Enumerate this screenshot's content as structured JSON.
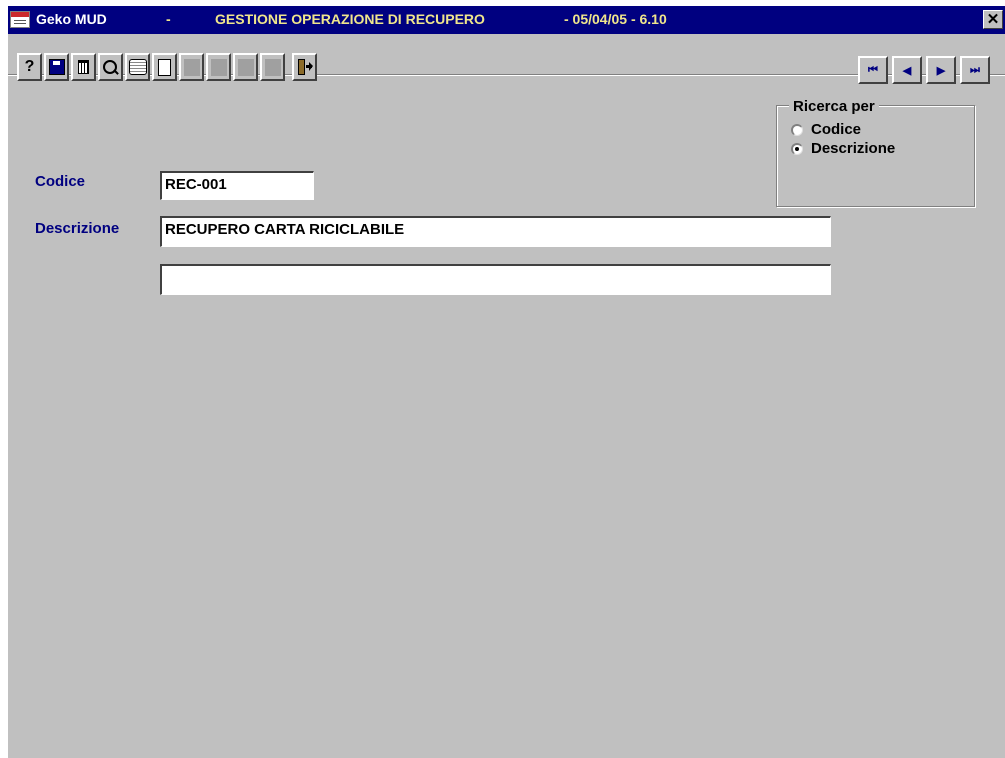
{
  "window": {
    "app_name": "Geko MUD",
    "separator": "-",
    "form_title": "GESTIONE OPERAZIONE DI RECUPERO",
    "datetime": "- 05/04/05 - 6.10",
    "close_label": "✕"
  },
  "toolbar": {
    "buttons": [
      {
        "name": "help-icon",
        "glyph": "?"
      },
      {
        "name": "save-icon",
        "glyph": "▪"
      },
      {
        "name": "trash-icon",
        "glyph": "🗑"
      },
      {
        "name": "search-icon",
        "glyph": "⌕"
      },
      {
        "name": "print-icon",
        "glyph": "❐"
      },
      {
        "name": "new-document-icon",
        "glyph": "▯"
      }
    ],
    "exit_glyph": "⏏"
  },
  "navigation": {
    "first": "⏮",
    "prev": "◀",
    "next": "▶",
    "last": "⏭"
  },
  "form": {
    "codice_label": "Codice",
    "codice_value": "REC-001",
    "descrizione_label": "Descrizione",
    "descrizione_value": "RECUPERO CARTA RICICLABILE",
    "descrizione2_value": ""
  },
  "search": {
    "legend": "Ricerca per",
    "options": [
      {
        "label": "Codice",
        "checked": false
      },
      {
        "label": "Descrizione",
        "checked": true
      }
    ]
  }
}
